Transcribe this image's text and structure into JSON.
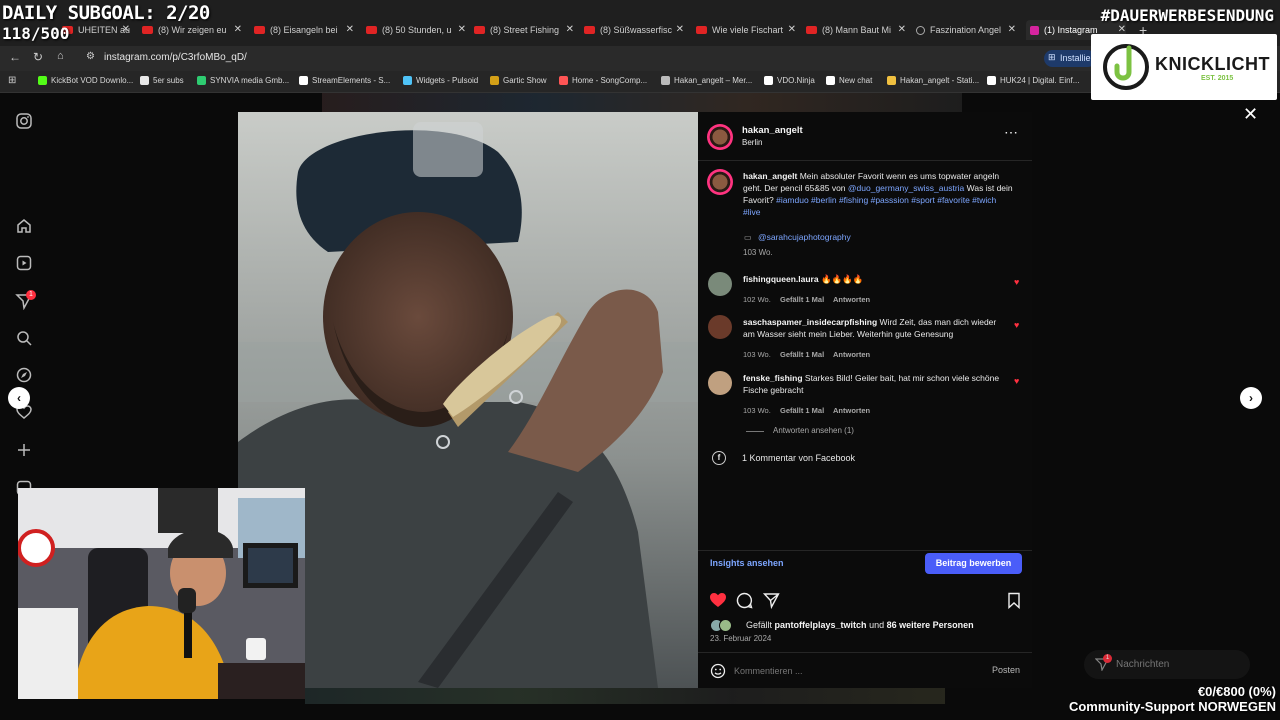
{
  "overlay": {
    "subgoal": "DAILY SUBGOAL: 2/20",
    "subcount": "118/500",
    "hashtag": "#DAUERWERBESENDUNG",
    "sponsor_name": "KNICKLICHT",
    "sponsor_est": "EST. 2015",
    "funds": "€0/€800 (0%)",
    "funds_label": "Community-Support NORWEGEN"
  },
  "browser": {
    "tabs": [
      {
        "label": "UHEITEN au",
        "type": "youtube"
      },
      {
        "label": "(8) Wir zeigen eu",
        "type": "youtube"
      },
      {
        "label": "(8) Eisangeln bei",
        "type": "youtube"
      },
      {
        "label": "(8) 50 Stunden, u",
        "type": "youtube"
      },
      {
        "label": "(8) Street Fishing",
        "type": "youtube"
      },
      {
        "label": "(8) Süßwasserfisc",
        "type": "youtube"
      },
      {
        "label": "Wie viele Fischart",
        "type": "youtube"
      },
      {
        "label": "(8) Mann Baut Mi",
        "type": "youtube"
      },
      {
        "label": "Faszination Angel",
        "type": "web"
      },
      {
        "label": "(1) Instagram",
        "type": "instagram"
      }
    ],
    "url": "instagram.com/p/C3rfoMBo_qD/",
    "install_label": "Installie",
    "bookmarks": [
      {
        "label": "KickBot VOD Downlo...",
        "color": "#53fc18"
      },
      {
        "label": "5er subs",
        "color": "#e8e8e8"
      },
      {
        "label": "SYNVIA media Gmb...",
        "color": "#2ecc71"
      },
      {
        "label": "StreamElements - S...",
        "color": "#ffffff"
      },
      {
        "label": "Widgets - Pulsoid",
        "color": "#4fc3f7"
      },
      {
        "label": "Gartic Show",
        "color": "#d4a017"
      },
      {
        "label": "Home - SongComp...",
        "color": "#ff5555"
      },
      {
        "label": "Hakan_angelt – Mer...",
        "color": "#bbbbbb"
      },
      {
        "label": "VDO.Ninja",
        "color": "#ffffff"
      },
      {
        "label": "New chat",
        "color": "#ffffff"
      },
      {
        "label": "Hakan_angelt - Stati...",
        "color": "#f0c040"
      },
      {
        "label": "HUK24 | Digital. Einf...",
        "color": "#ffffff"
      }
    ]
  },
  "instagram": {
    "rail_badge": "1",
    "messages_label": "Nachrichten",
    "messages_badge": "1",
    "post": {
      "username": "hakan_angelt",
      "location": "Berlin",
      "caption_user": "hakan_angelt",
      "caption_text": "Mein absoluter Favorit wenn es ums topwater angeln geht. Der pencil 65&85 von",
      "caption_mention": "@duo_germany_swiss_austria",
      "caption_question": "Was ist dein Favorit?",
      "caption_tags": "#iamduo #berlin #fishing #passsion #sport #favorite #twich #live",
      "photo_credit": "@sarahcujaphotography",
      "caption_age": "103 Wo.",
      "comments": [
        {
          "user": "fishingqueen.laura",
          "text": "🔥🔥🔥🔥",
          "age": "102 Wo.",
          "likes": "Gefällt 1 Mal",
          "reply": "Antworten",
          "avatar_color": "#7a8a7a"
        },
        {
          "user": "saschaspamer_insidecarpfishing",
          "text": "Wird Zeit, das man dich wieder am Wasser sieht mein Lieber. Weiterhin gute Genesung",
          "age": "103 Wo.",
          "likes": "Gefällt 1 Mal",
          "reply": "Antworten",
          "avatar_color": "#6a3a2a"
        },
        {
          "user": "fenske_fishing",
          "text": "Starkes Bild! Geiler bait, hat mir schon viele schöne Fische gebracht",
          "age": "103 Wo.",
          "likes": "Gefällt 1 Mal",
          "reply": "Antworten",
          "avatar_color": "#c0a080"
        }
      ],
      "view_replies": "Antworten ansehen (1)",
      "facebook_comments": "1 Kommentar von Facebook",
      "insights": "Insights ansehen",
      "promote": "Beitrag bewerben",
      "liked_prefix": "Gefällt",
      "liked_user": "pantoffelplays_twitch",
      "liked_suffix": "und",
      "liked_others": "86 weitere Personen",
      "date": "23. Februar 2024",
      "comment_placeholder": "Kommentieren ...",
      "post_button": "Posten"
    }
  }
}
